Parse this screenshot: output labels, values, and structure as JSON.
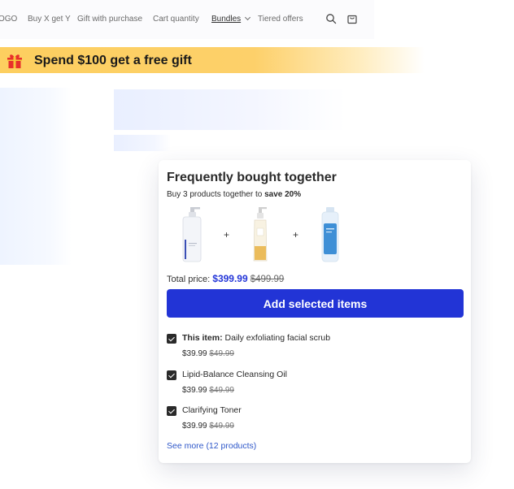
{
  "nav": {
    "links": [
      "OGO",
      "Buy X get Y",
      "Gift with purchase",
      "Cart quantity",
      "Bundles",
      "Tiered offers"
    ],
    "active_link": "Bundles"
  },
  "banner": {
    "text": "Spend $100 get a free gift",
    "icon": "gift-icon"
  },
  "widget": {
    "title": "Frequently bought together",
    "subtitle_prefix": "Buy 3 products together to ",
    "subtitle_bold": "save 20%",
    "plus": "+",
    "products": [
      {
        "name": "Daily exfoliating facial scrub",
        "image": "white-pump-bottle"
      },
      {
        "name": "Lipid-Balance Cleansing Oil",
        "image": "amber-pump-bottle"
      },
      {
        "name": "Clarifying Toner",
        "image": "blue-label-bottle"
      }
    ],
    "total_label": "Total price:",
    "total_price": "$399.99",
    "total_compare": "$499.99",
    "button_label": "Add selected items",
    "items": [
      {
        "prefix": "This item:",
        "name": "Daily exfoliating facial scrub",
        "price": "$39.99",
        "compare": "$49.99",
        "checked": true
      },
      {
        "prefix": "",
        "name": "Lipid-Balance Cleansing Oil",
        "price": "$39.99",
        "compare": "$49.99",
        "checked": true
      },
      {
        "prefix": "",
        "name": "Clarifying Toner",
        "price": "$39.99",
        "compare": "$49.99",
        "checked": true
      }
    ],
    "see_more": "See more (12 products)"
  },
  "colors": {
    "accent": "#2234d6",
    "link": "#2e57c9",
    "banner": "#fdcf5f"
  }
}
